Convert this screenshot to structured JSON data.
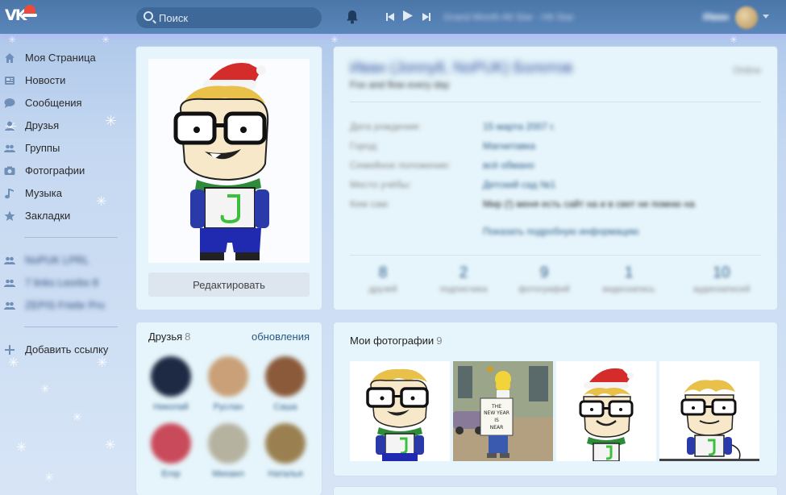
{
  "header": {
    "search_placeholder": "Поиск",
    "now_playing": "Grand Month All Star - Hit Star",
    "user_name": "Иван"
  },
  "sidebar": {
    "items": [
      {
        "label": "Моя Страница",
        "icon": "home-icon"
      },
      {
        "label": "Новости",
        "icon": "news-icon"
      },
      {
        "label": "Сообщения",
        "icon": "messages-icon"
      },
      {
        "label": "Друзья",
        "icon": "friends-icon"
      },
      {
        "label": "Группы",
        "icon": "groups-icon"
      },
      {
        "label": "Фотографии",
        "icon": "photo-icon"
      },
      {
        "label": "Музыка",
        "icon": "music-icon"
      },
      {
        "label": "Закладки",
        "icon": "star-icon"
      }
    ],
    "groups": [
      {
        "label": "NoPUK LPRL"
      },
      {
        "label": "7 links Leorbs 8"
      },
      {
        "label": "ZEPIS Friebr Pro"
      }
    ],
    "add_link": "Добавить ссылку"
  },
  "profile": {
    "edit_button": "Редактировать",
    "name": "Иван (Jonny8, NoPUK) Болотов",
    "online": "Online",
    "status": "Fox and flow every day",
    "fields": [
      {
        "key": "Дата рождения:",
        "value": "15 марта 2007 г."
      },
      {
        "key": "Город:",
        "value": "Магнитавка"
      },
      {
        "key": "Семейное положение:",
        "value": "всё обмано"
      },
      {
        "key": "Место учёбы:",
        "value": "Детский сад №1"
      },
      {
        "key": "Кем сам:",
        "value": "Мир (!) меня есть сайт на и в свет не помню на"
      }
    ],
    "more_link": "Показать подробную информацию",
    "counters": [
      {
        "n": "8",
        "l": "друзей"
      },
      {
        "n": "2",
        "l": "подписчика"
      },
      {
        "n": "9",
        "l": "фотографий"
      },
      {
        "n": "1",
        "l": "видеозапись"
      },
      {
        "n": "10",
        "l": "аудиозаписей"
      }
    ]
  },
  "friends": {
    "title": "Друзья",
    "count": "8",
    "updates_link": "обновления",
    "items": [
      {
        "name": "Николай",
        "color": "#1e2a44"
      },
      {
        "name": "Руслан",
        "color": "#c9a077"
      },
      {
        "name": "Саша",
        "color": "#8a5a3a"
      },
      {
        "name": "Егор",
        "color": "#c94a5a"
      },
      {
        "name": "Михаил",
        "color": "#b6b2a0"
      },
      {
        "name": "Наталья",
        "color": "#9a8050"
      }
    ]
  },
  "photos": {
    "title": "Мои фотографии",
    "count": "9",
    "simpsons_sign": "THE NEW YEAR IS NEAR"
  }
}
